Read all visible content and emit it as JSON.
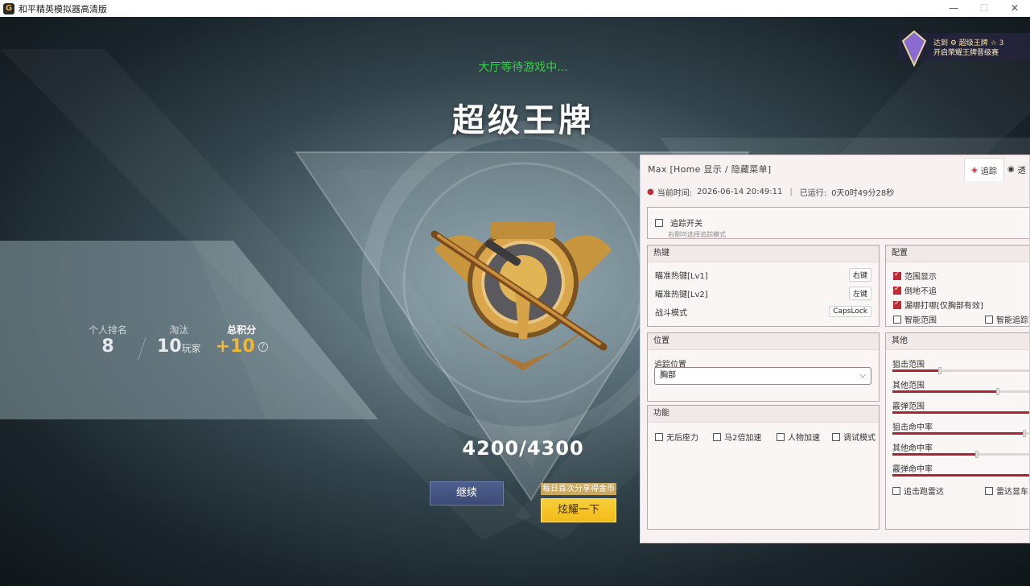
{
  "window": {
    "title": "和平精英模拟器高清版",
    "min": "—",
    "max": "☐",
    "close": "✕"
  },
  "game": {
    "status": "大厅等待游戏中...",
    "rank_title": "超级王牌",
    "stats": {
      "rank_label": "个人排名",
      "rank_value": "8",
      "elim_label": "淘汰",
      "elim_value": "10",
      "elim_unit": "玩家",
      "score_label": "总积分",
      "score_value": "+10",
      "help": "?"
    },
    "score_progress": "4200/4300",
    "continue_label": "继续",
    "share_tip": "每日首次分享得金币",
    "share_label": "炫耀一下",
    "season": {
      "line1": "达到 ⚙ 超级王牌 ☆ 3",
      "line2": "开启荣耀王牌晋级赛"
    }
  },
  "panel": {
    "header": "Max  [Home  显示 / 隐藏菜单]",
    "tabs": {
      "track": "追踪",
      "see": "透"
    },
    "time_label": "当前时间:",
    "time_value": "2026-06-14 20:49:11",
    "time_sep": "|",
    "run_label": "已运行:",
    "run_value": "0天0时49分28秒",
    "track_switch": {
      "label": "追踪开关",
      "sub": "右侧可选择追踪模式",
      "checked": false
    },
    "hotkeys": {
      "title": "热键",
      "rows": [
        {
          "label": "瞄准热键[Lv1]",
          "key": "右键"
        },
        {
          "label": "瞄准热键[Lv2]",
          "key": "左键"
        },
        {
          "label": "战斗模式",
          "key": "CapsLock"
        }
      ]
    },
    "config": {
      "title": "配置",
      "items": [
        {
          "label": "范围显示",
          "checked": true
        },
        {
          "label": "倒地不追",
          "checked": true
        },
        {
          "label": "漏哪打哪[仅胸部有效]",
          "checked": true
        },
        {
          "label": "智能范围",
          "checked": false
        },
        {
          "label": "智能追踪",
          "checked": false
        }
      ]
    },
    "position": {
      "title": "位置",
      "field_label": "追踪位置",
      "value": "胸部",
      "caret": "⌵"
    },
    "function": {
      "title": "功能",
      "items": [
        {
          "label": "无后座力",
          "checked": false
        },
        {
          "label": "马2倍加速",
          "checked": false
        },
        {
          "label": "人物加速",
          "checked": false
        },
        {
          "label": "调试模式",
          "checked": false
        }
      ]
    },
    "other": {
      "title": "其他",
      "sliders": [
        {
          "label": "狙击范围",
          "value": 0.3
        },
        {
          "label": "其他范围",
          "value": 0.68
        },
        {
          "label": "霰弹范围",
          "value": 0.9
        },
        {
          "label": "狙击命中率",
          "value": 0.85
        },
        {
          "label": "其他命中率",
          "value": 0.54
        },
        {
          "label": "霰弹命中率",
          "value": 1.0
        }
      ],
      "items": [
        {
          "label": "追击跑雷达",
          "checked": false
        },
        {
          "label": "雷达显车",
          "checked": false
        }
      ]
    }
  },
  "colors": {
    "accent_red": "#c02a33",
    "status_green": "#38d04b",
    "gold": "#f0b635"
  }
}
